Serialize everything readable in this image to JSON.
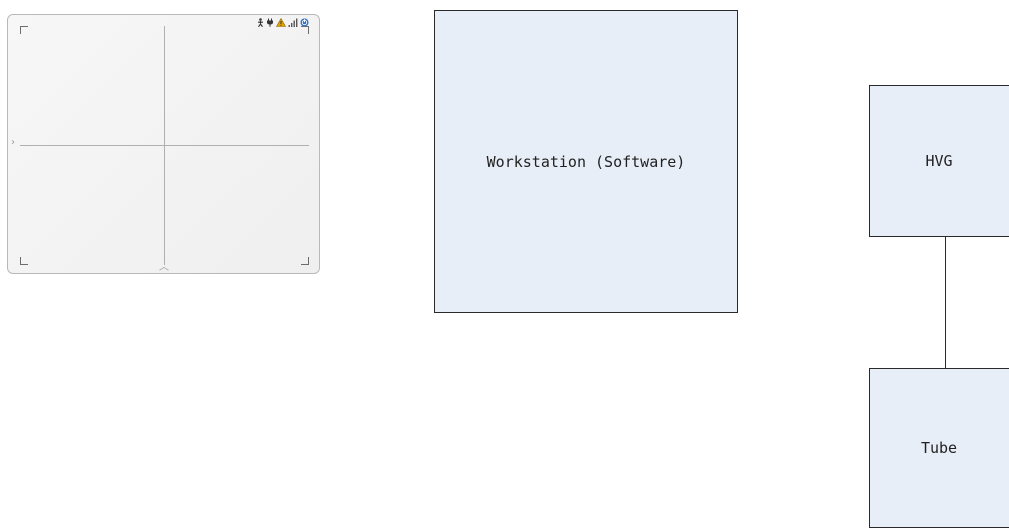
{
  "detector": {
    "status_icons": [
      "person-icon",
      "plug-icon",
      "warning-icon",
      "signal-bars-icon",
      "power-icon"
    ]
  },
  "diagram": {
    "workstation_label": "Workstation (Software)",
    "hvg_label": "HVG",
    "tube_label": "Tube"
  },
  "colors": {
    "box_fill": "#e8eef8",
    "box_border": "#2a2a2a",
    "detector_border": "#b9b9b9",
    "warning": "#e2a300",
    "power": "#2f6fc9"
  }
}
